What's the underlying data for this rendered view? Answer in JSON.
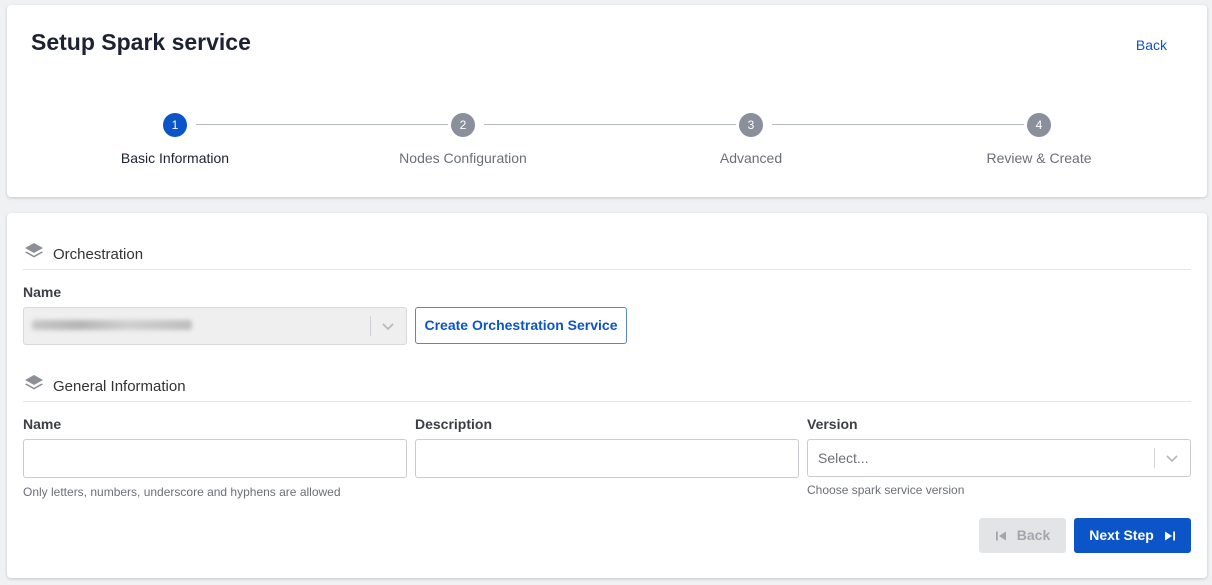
{
  "header": {
    "title": "Setup Spark service",
    "back_label": "Back"
  },
  "steps": [
    {
      "number": "1",
      "label": "Basic Information",
      "active": true
    },
    {
      "number": "2",
      "label": "Nodes Configuration",
      "active": false
    },
    {
      "number": "3",
      "label": "Advanced",
      "active": false
    },
    {
      "number": "4",
      "label": "Review & Create",
      "active": false
    }
  ],
  "orchestration": {
    "section_title": "Orchestration",
    "name_label": "Name",
    "create_button_label": "Create Orchestration Service"
  },
  "general": {
    "section_title": "General Information",
    "name_label": "Name",
    "name_value": "",
    "name_hint": "Only letters, numbers, underscore and hyphens are allowed",
    "description_label": "Description",
    "description_value": "",
    "version_label": "Version",
    "version_placeholder": "Select...",
    "version_hint": "Choose spark service version"
  },
  "footer": {
    "back_label": "Back",
    "next_label": "Next Step"
  },
  "colors": {
    "primary": "#0b55c8",
    "inactive_step": "#8a8f9c",
    "disabled_button": "#e3e4e6"
  }
}
